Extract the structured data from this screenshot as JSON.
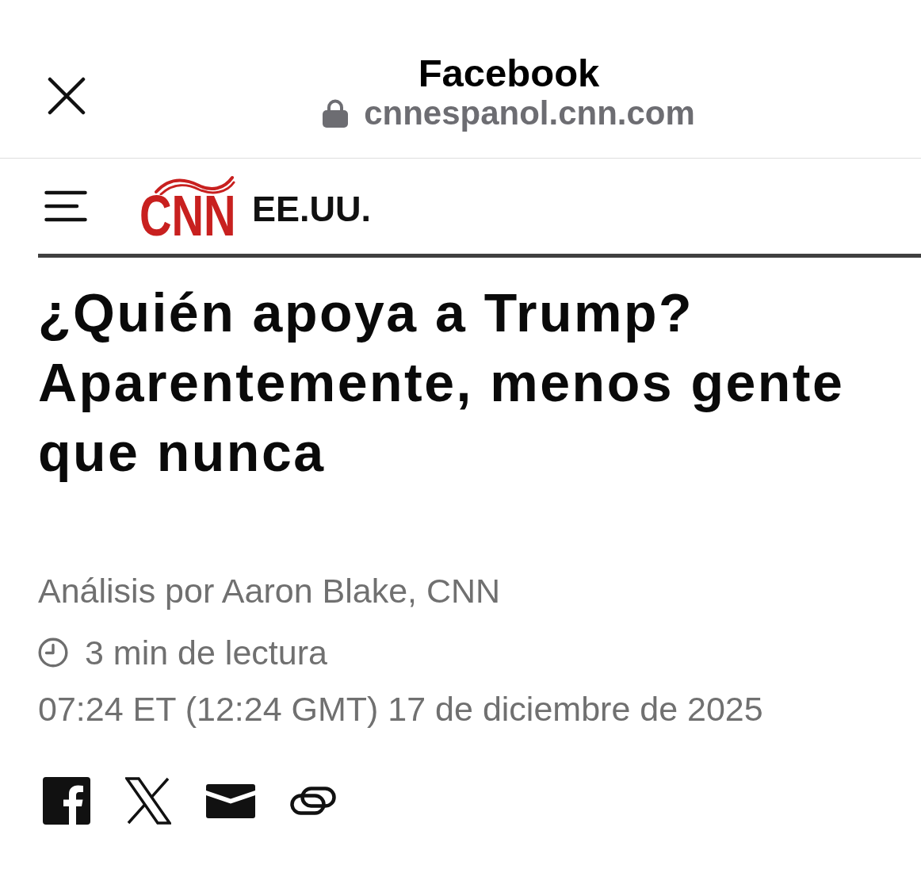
{
  "browser_bar": {
    "title": "Facebook",
    "url": "cnnespanol.cnn.com",
    "secure": true
  },
  "site_header": {
    "logo": "CNN",
    "section": "EE.UU."
  },
  "article": {
    "headline": "¿Quién apoya a Trump? Aparentemente, menos gente que nunca",
    "byline": "Análisis por Aaron Blake, CNN",
    "read_time": "3 min de lectura",
    "timestamp": "07:24 ET (12:24 GMT) 17 de diciembre de 2025",
    "share_buttons": [
      {
        "kind": "facebook"
      },
      {
        "kind": "x"
      },
      {
        "kind": "email"
      },
      {
        "kind": "link"
      }
    ]
  }
}
